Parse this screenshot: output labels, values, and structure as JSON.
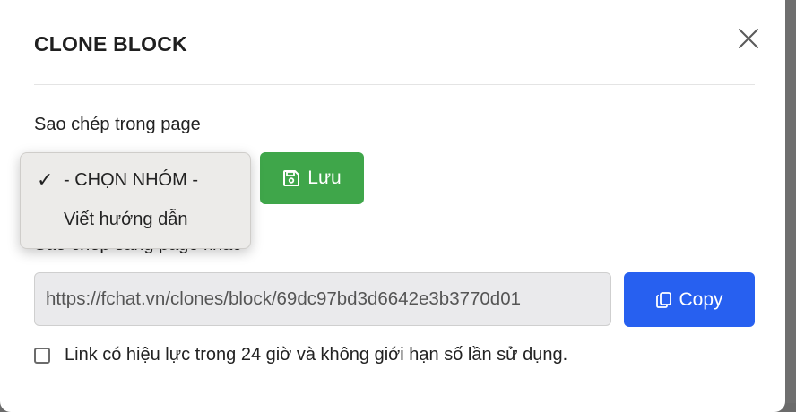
{
  "modal": {
    "title": "CLONE BLOCK",
    "same_page_label": "Sao chép trong page",
    "other_page_label": "Sao chép sang page khác",
    "select": {
      "options": [
        {
          "label": "- CHỌN NHÓM -",
          "selected": true
        },
        {
          "label": "Viết hướng dẫn",
          "selected": false
        }
      ],
      "check_glyph": "✓"
    },
    "save_label": "Lưu",
    "url_value": "https://fchat.vn/clones/block/69dc97bd3d6642e3b3770d01",
    "copy_label": "Copy",
    "checkbox_label": "Link có hiệu lực trong 24 giờ và không giới hạn số lần sử dụng.",
    "checkbox_checked": false
  },
  "icons": {
    "close": "close-icon",
    "save": "floppy-disk-icon",
    "copy": "copy-icon"
  },
  "colors": {
    "save_button": "#3fa64a",
    "copy_button": "#2760f0",
    "dropdown_bg": "#ecebe9"
  }
}
